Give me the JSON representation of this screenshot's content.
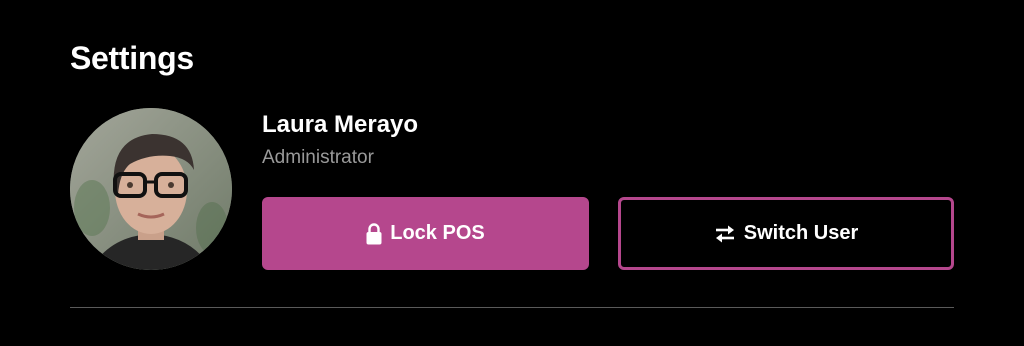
{
  "page": {
    "title": "Settings"
  },
  "user": {
    "name": "Laura Merayo",
    "role": "Administrator"
  },
  "actions": {
    "lock_label": "Lock POS",
    "lock_icon": "lock-icon",
    "switch_label": "Switch User",
    "switch_icon": "swap-arrows-icon"
  },
  "colors": {
    "background": "#000000",
    "accent": "#b5478d",
    "secondary_text": "#9a9a9a",
    "divider": "#5a5a5a"
  }
}
